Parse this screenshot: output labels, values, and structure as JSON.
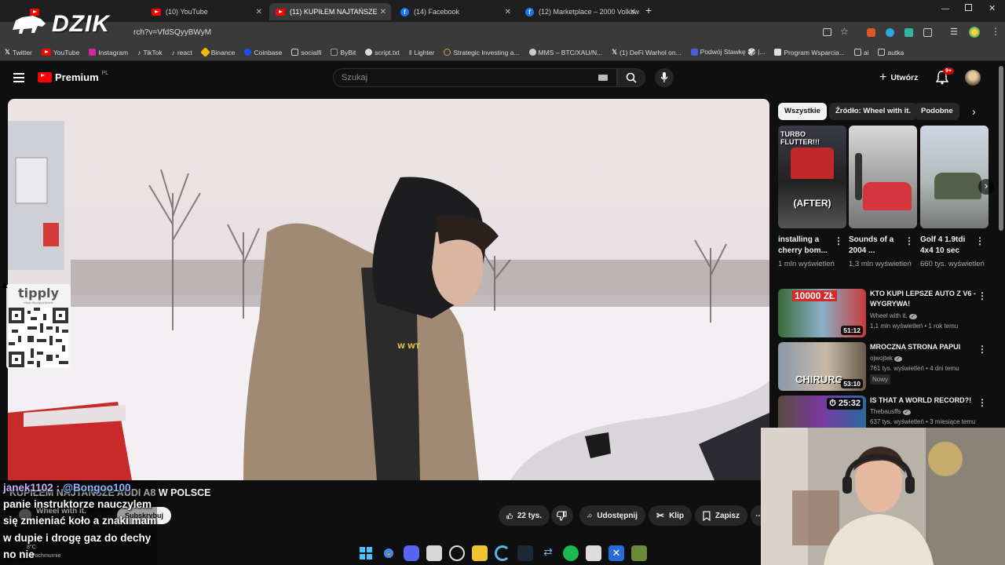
{
  "browser": {
    "tabs": [
      {
        "title": "(10) YouTube",
        "type": "youtube"
      },
      {
        "title": "(11) KUPIŁEM NAJTAŃSZE",
        "type": "youtube",
        "active": true
      },
      {
        "title": "(14) Facebook",
        "type": "facebook"
      },
      {
        "title": "(12) Marketplace – 2000 Volksw",
        "type": "facebook"
      }
    ],
    "new_tab": "+",
    "url": "rch?v=VfdSQyyBWyM",
    "bookmarks": [
      "Twitter",
      "YouTube",
      "Instagram",
      "TikTok",
      "react",
      "Binance",
      "Coinbase",
      "socialfi",
      "ByBit",
      "script.txt",
      "Lighter",
      "Strategic Investing a...",
      "MMS – BTC/XAU/N...",
      "(1) DeFi Warhol on...",
      "Podwój Stawkę 🎲 |...",
      "Program Wsparcia...",
      "ai",
      "autka"
    ]
  },
  "stream_logo": "DZIK",
  "youtube": {
    "logo_text": "Premium",
    "logo_region": "PL",
    "search_placeholder": "Szukaj",
    "create_label": "Utwórz",
    "notif_count": "9+"
  },
  "video": {
    "title": "KUPIŁEM NAJTAŃSZE AUDI A8 W POLSCE",
    "channel": "Wheel with it.",
    "subscribe_label": "Subskrybuj",
    "likes": "22 tys.",
    "share_label": "Udostępnij",
    "clip_label": "Klip",
    "save_label": "Zapisz",
    "shirt_text": "W WT"
  },
  "tipply": {
    "brand": "tipply",
    "url": "https://tipply.pl/@dzik"
  },
  "chips": [
    "Wszystkie",
    "Źródło: Wheel with it.",
    "Podobne"
  ],
  "shorts": [
    {
      "title": "installing a cherry bom...",
      "views": "1 mln wyświetleń",
      "overlay_top": "TURBO FLUTTER!!!",
      "overlay_mid": "(AFTER)"
    },
    {
      "title": "Sounds of a 2004 ...",
      "views": "1,3 mln wyświetleń"
    },
    {
      "title": "Golf 4 1.9tdi 4x4 10 sec",
      "views": "660 tys. wyświetleń"
    }
  ],
  "recommendations": [
    {
      "title": "KTO KUPI LEPSZE AUTO Z V6 - WYGRYWA!",
      "channel": "Wheel with it.",
      "meta": "1,1 mln wyświetleń • 1 rok temu",
      "duration": "51:12",
      "thumb_text": "10000 ZŁ"
    },
    {
      "title": "MROCZNA STRONA PAPUI",
      "channel": "ojwojtek",
      "meta": "761 tys. wyświetleń • 4 dni temu",
      "duration": "53:10",
      "badge": "Nowy",
      "thumb_text": "CHIRURG"
    },
    {
      "title": "IS THAT A WORLD RECORD?!",
      "channel": "Thebausffs",
      "meta": "637 tys. wyświetleń • 3 miesiące temu",
      "duration": "25:32"
    }
  ],
  "chat": {
    "user": "janek1102",
    "mention": "@Bongoo100",
    "lines": [
      "panie instruktorze nauczylem",
      "się zmieniać koło a znaki mam",
      "w dupie i drogę gaz do dechy",
      "no nie"
    ]
  },
  "weather": {
    "temp": "8°C",
    "desc": "Pochmurnie"
  },
  "colors": {
    "yt_red": "#ff0000",
    "accent_blue": "#3ea6ff"
  }
}
